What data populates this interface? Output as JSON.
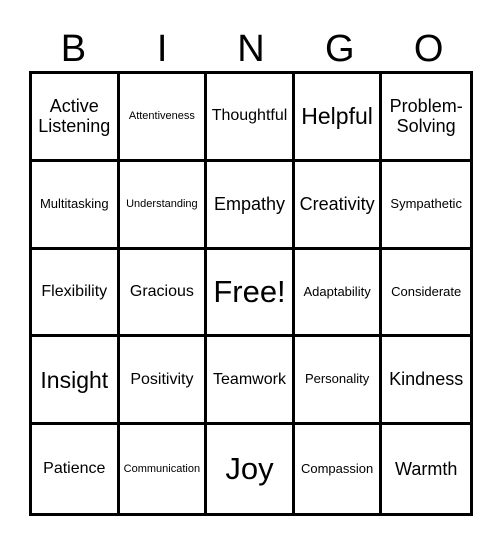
{
  "header": {
    "letters": [
      "B",
      "I",
      "N",
      "G",
      "O"
    ]
  },
  "board": {
    "rows": [
      [
        "Active Listening",
        "Attentiveness",
        "Thoughtful",
        "Helpful",
        "Problem-Solving"
      ],
      [
        "Multitasking",
        "Understanding",
        "Empathy",
        "Creativity",
        "Sympathetic"
      ],
      [
        "Flexibility",
        "Gracious",
        "Free!",
        "Adaptability",
        "Considerate"
      ],
      [
        "Insight",
        "Positivity",
        "Teamwork",
        "Personality",
        "Kindness"
      ],
      [
        "Patience",
        "Communication",
        "Joy",
        "Compassion",
        "Warmth"
      ]
    ],
    "free_space": "Free!"
  }
}
